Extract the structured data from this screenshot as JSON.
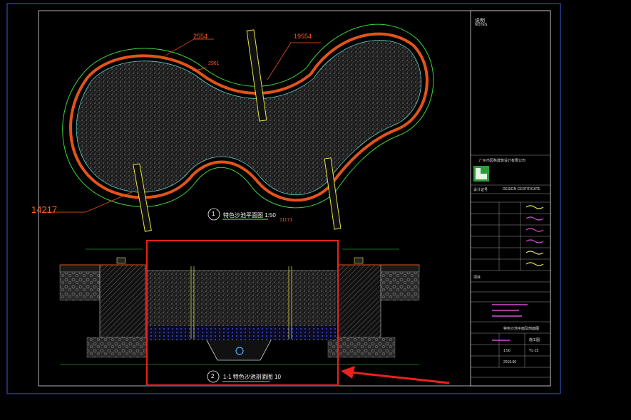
{
  "drawing": {
    "dimensions": {
      "d1": "2554",
      "d2": "19554",
      "d3": "2961",
      "d4": "14217",
      "d5": "11171"
    },
    "plan_title_number": "1",
    "plan_title": "特色沙池平面图 1:50",
    "section_title_number": "2",
    "section_title": "1-1 特色沙池剖面图 10"
  },
  "title_block": {
    "notes_label": "说明",
    "notes_label_en": "NOTES",
    "company": "广州市园林建筑设计有限公司",
    "design_no_label": "设计证号",
    "design_no": "DESIGN CERTIFICATE",
    "project_label": "项目",
    "drawing_name": "特色沙池平面及剖面图",
    "stage": "施工图",
    "scale": "1:50",
    "sheet": "YL-15",
    "date": "2019.06"
  },
  "colors": {
    "frame": "#3b5bdc",
    "boundary_green": "#3cd43c",
    "rim_orange": "#e2541a",
    "sand_edge_cyan": "#5fd0c8",
    "highlight_red": "#e8221c",
    "yellow_line": "#e6e642",
    "title_pink": "#d64fd6"
  }
}
